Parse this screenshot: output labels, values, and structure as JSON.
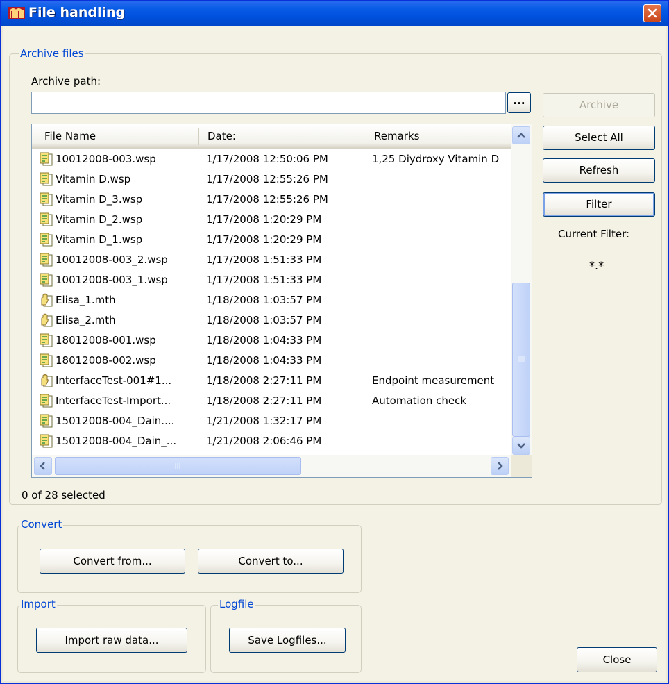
{
  "window": {
    "title": "File handling"
  },
  "archive": {
    "legend": "Archive files",
    "path_label": "Archive path:",
    "path_value": "",
    "browse_label": "...",
    "archive_button": "Archive",
    "select_all_button": "Select All",
    "refresh_button": "Refresh",
    "filter_button": "Filter",
    "current_filter_label": "Current Filter:",
    "current_filter_value": "*.*",
    "selection_status": "0 of 28 selected"
  },
  "file_list": {
    "columns": [
      "File Name",
      "Date:",
      "Remarks"
    ],
    "rows": [
      {
        "name": "10012008-003.wsp",
        "date": "1/17/2008 12:50:06 PM",
        "remarks": "1,25 Diydroxy Vitamin D",
        "icon": "wsp-file-icon"
      },
      {
        "name": "Vitamin D.wsp",
        "date": "1/17/2008 12:55:26 PM",
        "remarks": "",
        "icon": "wsp-file-icon"
      },
      {
        "name": "Vitamin D_3.wsp",
        "date": "1/17/2008 12:55:26 PM",
        "remarks": "",
        "icon": "wsp-file-icon"
      },
      {
        "name": "Vitamin D_2.wsp",
        "date": "1/17/2008 1:20:29 PM",
        "remarks": "",
        "icon": "wsp-file-icon"
      },
      {
        "name": "Vitamin D_1.wsp",
        "date": "1/17/2008 1:20:29 PM",
        "remarks": "",
        "icon": "wsp-file-icon"
      },
      {
        "name": "10012008-003_2.wsp",
        "date": "1/17/2008 1:51:33 PM",
        "remarks": "",
        "icon": "wsp-file-icon"
      },
      {
        "name": "10012008-003_1.wsp",
        "date": "1/17/2008 1:51:33 PM",
        "remarks": "",
        "icon": "wsp-file-icon"
      },
      {
        "name": "Elisa_1.mth",
        "date": "1/18/2008 1:03:57 PM",
        "remarks": "",
        "icon": "mth-file-icon"
      },
      {
        "name": "Elisa_2.mth",
        "date": "1/18/2008 1:03:57 PM",
        "remarks": "",
        "icon": "mth-file-icon"
      },
      {
        "name": "18012008-001.wsp",
        "date": "1/18/2008 1:04:33 PM",
        "remarks": "",
        "icon": "wsp-file-icon"
      },
      {
        "name": "18012008-002.wsp",
        "date": "1/18/2008 1:04:33 PM",
        "remarks": "",
        "icon": "wsp-file-icon"
      },
      {
        "name": "InterfaceTest-001#1...",
        "date": "1/18/2008 2:27:11 PM",
        "remarks": "Endpoint measurement",
        "icon": "mth-file-icon"
      },
      {
        "name": "InterfaceTest-Import...",
        "date": "1/18/2008 2:27:11 PM",
        "remarks": "Automation check",
        "icon": "wsp-file-icon"
      },
      {
        "name": "15012008-004_Dain....",
        "date": "1/21/2008 1:32:17 PM",
        "remarks": "",
        "icon": "wsp-file-icon"
      },
      {
        "name": "15012008-004_Dain_...",
        "date": "1/21/2008 2:06:46 PM",
        "remarks": "",
        "icon": "wsp-file-icon"
      }
    ]
  },
  "convert": {
    "legend": "Convert",
    "from_button": "Convert from...",
    "to_button": "Convert to..."
  },
  "import": {
    "legend": "Import",
    "raw_button": "Import raw data..."
  },
  "logfile": {
    "legend": "Logfile",
    "save_button": "Save Logfiles..."
  },
  "close_button": "Close",
  "colors": {
    "titlebar": "#0055e5",
    "accent": "#0046d5",
    "dialog_bg": "#f4f2e4"
  }
}
